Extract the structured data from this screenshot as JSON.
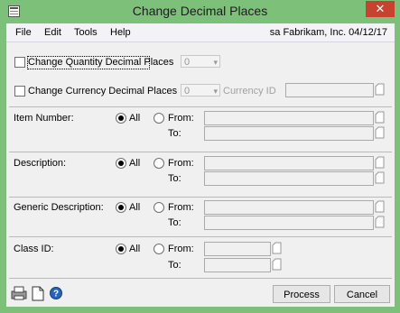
{
  "window": {
    "title": "Change Decimal Places",
    "close_glyph": "✕"
  },
  "menu": {
    "items": [
      "File",
      "Edit",
      "Tools",
      "Help"
    ],
    "company": "sa  Fabrikam, Inc.  04/12/17"
  },
  "decimal": {
    "quantity_label": "Change Quantity Decimal Places",
    "quantity_value": "0",
    "currency_label": "Change Currency Decimal Places",
    "currency_value": "0",
    "currency_id_label": "Currency ID"
  },
  "ranges": [
    {
      "label": "Item Number:",
      "all": "All",
      "from": "From:",
      "to": "To:"
    },
    {
      "label": "Description:",
      "all": "All",
      "from": "From:",
      "to": "To:"
    },
    {
      "label": "Generic Description:",
      "all": "All",
      "from": "From:",
      "to": "To:"
    },
    {
      "label": "Class ID:",
      "all": "All",
      "from": "From:",
      "to": "To:"
    }
  ],
  "buttons": {
    "process": "Process",
    "cancel": "Cancel"
  },
  "colors": {
    "frame": "#7cc07a",
    "close": "#c7432f"
  }
}
